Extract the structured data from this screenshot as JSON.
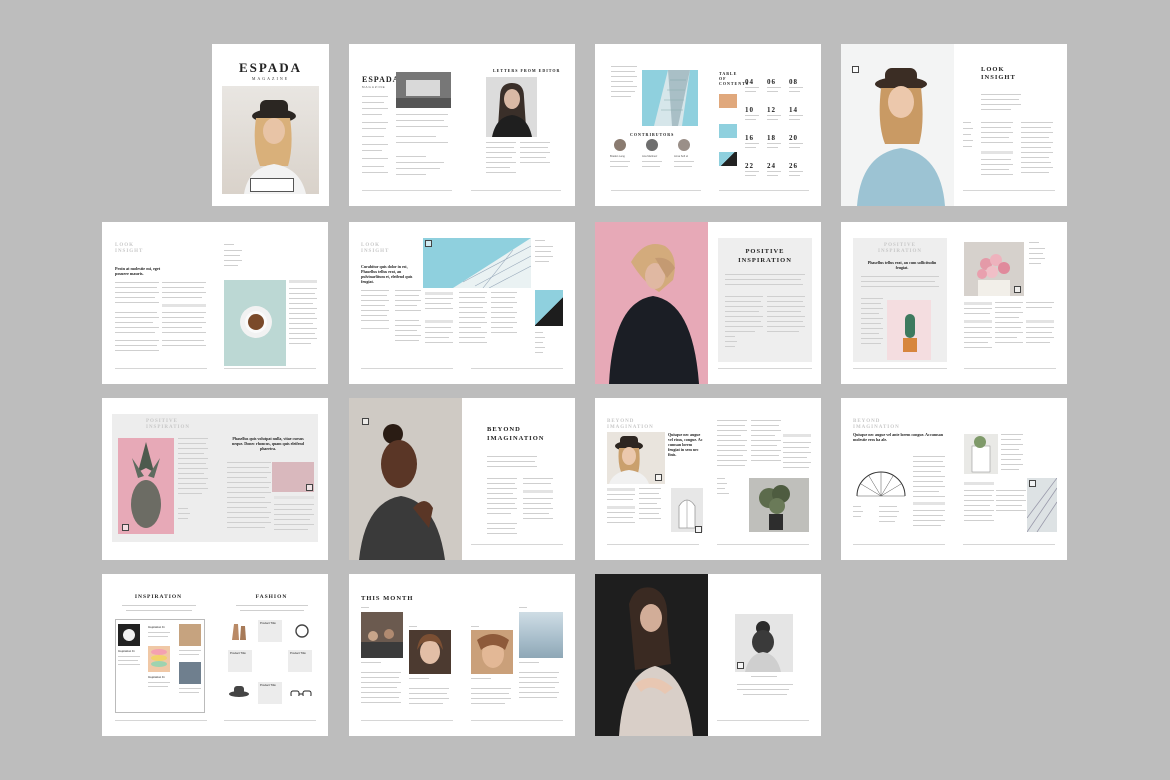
{
  "brand": {
    "title": "ESPADA",
    "subtitle": "MAGAZINE"
  },
  "headings": {
    "letters_from_editor": "LETTERS FROM EDITOR",
    "contributors": "CONTRIBUTORS",
    "table_of_contents_1": "TABLE",
    "table_of_contents_2": "OF",
    "table_of_contents_3": "CONTENTS",
    "look_insight_1": "LOOK",
    "look_insight_2": "INSIGHT",
    "positive_inspiration_1": "POSITIVE",
    "positive_inspiration_2": "INSPIRATION",
    "beyond_imagination_1": "BEYOND",
    "beyond_imagination_2": "IMAGINATION",
    "inspiration": "INSPIRATION",
    "fashion": "FASHION",
    "this_month": "THIS MONTH"
  },
  "toc_numbers": [
    "04",
    "06",
    "08",
    "10",
    "12",
    "14",
    "16",
    "18",
    "20",
    "22",
    "24",
    "26"
  ],
  "pull_quotes": {
    "p5": "Proin at molestie mi, eget posuere mauris.",
    "p6": "Curabitur quis dolor in est, Phasellus tellus erat, an pulvinarlitum et, eleifend quis feugiat.",
    "p8": "Phasellus tellus erat, an cum sollicitudin feugiat.",
    "p9": "Phasellus quis volutpat nulla, vitae cursus neque. Donec rhoncus, quam quis eleifend pharetra.",
    "p11": "Quisque nec augue vel risus, congue. Ac cumsan lorem feugiat in sem nec finis.",
    "p12": "Quisque nec augue vel ante lorem congue. Accumsan molestie eros ha ale."
  },
  "contributors": [
    "Braden Lang",
    "Ana Martinez",
    "Anna Sofi el"
  ],
  "product_title": "Product Title",
  "inspiration_label": "Inspiration 11",
  "section_label": "FASHION",
  "colors": {
    "background": "#bdbdbd",
    "pink": "#e7a9b7",
    "sky": "#8fd0de",
    "gray_panel": "#eeeeee"
  }
}
